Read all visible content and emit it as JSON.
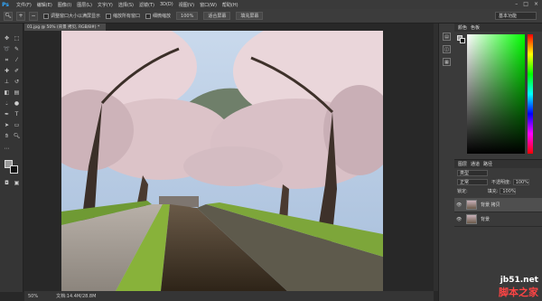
{
  "app": {
    "logo": "Ps"
  },
  "menu": [
    "文件(F)",
    "编辑(E)",
    "图像(I)",
    "图层(L)",
    "文字(Y)",
    "选择(S)",
    "滤镜(T)",
    "3D(D)",
    "视图(V)",
    "窗口(W)",
    "帮助(H)"
  ],
  "window_controls": [
    "–",
    "□",
    "×"
  ],
  "options": {
    "resize_label": "调整窗口大小以满屏显示",
    "zoom_all_label": "缩放所有窗口",
    "scrubby_label": "细微缩放",
    "zoom_value": "100%",
    "fit_screen": "适合屏幕",
    "fill_screen": "填充屏幕",
    "workspace": "基本功能"
  },
  "document": {
    "tab_title": "01.jpg @ 50% (背景 拷贝, RGB/8#) *",
    "zoom": "50%",
    "doc_size": "文档:14.4M/28.8M"
  },
  "color_panel": {
    "tabs": [
      "颜色",
      "色板"
    ]
  },
  "layers_panel": {
    "tabs": [
      "图层",
      "通道",
      "路径"
    ],
    "kind_label": "类型",
    "blend_mode": "正常",
    "opacity_label": "不透明度:",
    "opacity": "100%",
    "lock_label": "锁定:",
    "fill_label": "填充:",
    "fill": "100%",
    "layers": [
      {
        "name": "背景 拷贝",
        "selected": true
      },
      {
        "name": "背景",
        "selected": false
      }
    ]
  },
  "watermark": {
    "line1": "jb51.net",
    "line2": "脚本之家"
  },
  "colors": {
    "accent": "#31a8ff",
    "panel": "#3a3a3a",
    "canvas_bg": "#282828"
  }
}
